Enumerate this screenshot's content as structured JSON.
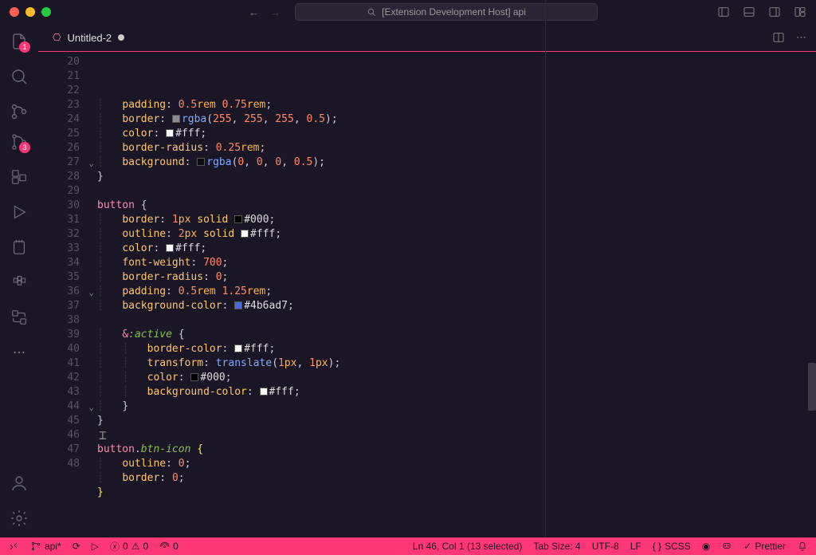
{
  "title": "[Extension Development Host] api",
  "tab": {
    "name": "Untitled-2"
  },
  "badges": {
    "explorer": "1",
    "scm": "3"
  },
  "gutter_start": 20,
  "folds": {
    "27": true,
    "36": true,
    "44": true
  },
  "code": [
    {
      "i": "    ",
      "t": [
        [
          "prop",
          "padding"
        ],
        [
          "punct",
          ": "
        ],
        [
          "num",
          "0.5"
        ],
        [
          "unit",
          "rem "
        ],
        [
          "num",
          "0.75"
        ],
        [
          "unit",
          "rem"
        ],
        [
          "punct",
          ";"
        ]
      ]
    },
    {
      "i": "    ",
      "t": [
        [
          "prop",
          "border"
        ],
        [
          "punct",
          ": "
        ],
        [
          "swatch",
          "rgba(255,255,255,0.5)"
        ],
        [
          "func",
          "rgba"
        ],
        [
          "punct",
          "("
        ],
        [
          "num",
          "255"
        ],
        [
          "punct",
          ", "
        ],
        [
          "num",
          "255"
        ],
        [
          "punct",
          ", "
        ],
        [
          "num",
          "255"
        ],
        [
          "punct",
          ", "
        ],
        [
          "num",
          "0.5"
        ],
        [
          "punct",
          ")"
        ],
        [
          "punct",
          ";"
        ]
      ]
    },
    {
      "i": "    ",
      "t": [
        [
          "prop",
          "color"
        ],
        [
          "punct",
          ": "
        ],
        [
          "swatch",
          "#fff"
        ],
        [
          "hex",
          "#fff"
        ],
        [
          "punct",
          ";"
        ]
      ]
    },
    {
      "i": "    ",
      "t": [
        [
          "prop",
          "border-radius"
        ],
        [
          "punct",
          ": "
        ],
        [
          "num",
          "0.25"
        ],
        [
          "unit",
          "rem"
        ],
        [
          "punct",
          ";"
        ]
      ]
    },
    {
      "i": "    ",
      "t": [
        [
          "prop",
          "background"
        ],
        [
          "punct",
          ": "
        ],
        [
          "swatch",
          "rgba(0,0,0,0.5)"
        ],
        [
          "func",
          "rgba"
        ],
        [
          "punct",
          "("
        ],
        [
          "num",
          "0"
        ],
        [
          "punct",
          ", "
        ],
        [
          "num",
          "0"
        ],
        [
          "punct",
          ", "
        ],
        [
          "num",
          "0"
        ],
        [
          "punct",
          ", "
        ],
        [
          "num",
          "0.5"
        ],
        [
          "punct",
          ")"
        ],
        [
          "punct",
          ";"
        ]
      ]
    },
    {
      "i": "",
      "t": [
        [
          "brace",
          "}"
        ]
      ]
    },
    {
      "i": "",
      "t": []
    },
    {
      "i": "",
      "t": [
        [
          "sel",
          "button "
        ],
        [
          "brace",
          "{"
        ]
      ]
    },
    {
      "i": "    ",
      "t": [
        [
          "prop",
          "border"
        ],
        [
          "punct",
          ": "
        ],
        [
          "num",
          "1"
        ],
        [
          "unit",
          "px "
        ],
        [
          "kw",
          "solid "
        ],
        [
          "swatch",
          "#000"
        ],
        [
          "hex",
          "#000"
        ],
        [
          "punct",
          ";"
        ]
      ]
    },
    {
      "i": "    ",
      "t": [
        [
          "prop",
          "outline"
        ],
        [
          "punct",
          ": "
        ],
        [
          "num",
          "2"
        ],
        [
          "unit",
          "px "
        ],
        [
          "kw",
          "solid "
        ],
        [
          "swatch",
          "#fff"
        ],
        [
          "hex",
          "#fff"
        ],
        [
          "punct",
          ";"
        ]
      ]
    },
    {
      "i": "    ",
      "t": [
        [
          "prop",
          "color"
        ],
        [
          "punct",
          ": "
        ],
        [
          "swatch",
          "#fff"
        ],
        [
          "hex",
          "#fff"
        ],
        [
          "punct",
          ";"
        ]
      ]
    },
    {
      "i": "    ",
      "t": [
        [
          "prop",
          "font-weight"
        ],
        [
          "punct",
          ": "
        ],
        [
          "num",
          "700"
        ],
        [
          "punct",
          ";"
        ]
      ]
    },
    {
      "i": "    ",
      "t": [
        [
          "prop",
          "border-radius"
        ],
        [
          "punct",
          ": "
        ],
        [
          "num",
          "0"
        ],
        [
          "punct",
          ";"
        ]
      ]
    },
    {
      "i": "    ",
      "t": [
        [
          "prop",
          "padding"
        ],
        [
          "punct",
          ": "
        ],
        [
          "num",
          "0.5"
        ],
        [
          "unit",
          "rem "
        ],
        [
          "num",
          "1.25"
        ],
        [
          "unit",
          "rem"
        ],
        [
          "punct",
          ";"
        ]
      ]
    },
    {
      "i": "    ",
      "t": [
        [
          "prop",
          "background-color"
        ],
        [
          "punct",
          ": "
        ],
        [
          "swatch",
          "#4b6ad7"
        ],
        [
          "hex",
          "#4b6ad7"
        ],
        [
          "punct",
          ";"
        ]
      ]
    },
    {
      "i": "",
      "t": []
    },
    {
      "i": "    ",
      "t": [
        [
          "sel",
          "&"
        ],
        [
          "selg",
          ":active "
        ],
        [
          "brace",
          "{"
        ]
      ]
    },
    {
      "i": "        ",
      "t": [
        [
          "prop",
          "border-color"
        ],
        [
          "punct",
          ": "
        ],
        [
          "swatch",
          "#fff"
        ],
        [
          "hex",
          "#fff"
        ],
        [
          "punct",
          ";"
        ]
      ]
    },
    {
      "i": "        ",
      "t": [
        [
          "prop",
          "transform"
        ],
        [
          "punct",
          ": "
        ],
        [
          "func",
          "translate"
        ],
        [
          "punct",
          "("
        ],
        [
          "num",
          "1"
        ],
        [
          "unit",
          "px"
        ],
        [
          "punct",
          ", "
        ],
        [
          "num",
          "1"
        ],
        [
          "unit",
          "px"
        ],
        [
          "punct",
          ")"
        ],
        [
          "punct",
          ";"
        ]
      ]
    },
    {
      "i": "        ",
      "t": [
        [
          "prop",
          "color"
        ],
        [
          "punct",
          ": "
        ],
        [
          "swatch",
          "#000"
        ],
        [
          "hex",
          "#000"
        ],
        [
          "punct",
          ";"
        ]
      ]
    },
    {
      "i": "        ",
      "t": [
        [
          "prop",
          "background-color"
        ],
        [
          "punct",
          ": "
        ],
        [
          "swatch",
          "#fff"
        ],
        [
          "hex",
          "#fff"
        ],
        [
          "punct",
          ";"
        ]
      ]
    },
    {
      "i": "    ",
      "t": [
        [
          "brace",
          "}"
        ]
      ]
    },
    {
      "i": "",
      "t": [
        [
          "brace",
          "}"
        ]
      ]
    },
    {
      "i": "",
      "t": []
    },
    {
      "i": "",
      "t": [
        [
          "sel",
          "button"
        ],
        [
          "punct",
          "."
        ],
        [
          "selg",
          "btn-icon "
        ],
        [
          "curbrace",
          "{"
        ]
      ]
    },
    {
      "i": "    ",
      "t": [
        [
          "prop",
          "outline"
        ],
        [
          "punct",
          ": "
        ],
        [
          "num",
          "0"
        ],
        [
          "punct",
          ";"
        ]
      ]
    },
    {
      "i": "    ",
      "t": [
        [
          "prop",
          "border"
        ],
        [
          "punct",
          ": "
        ],
        [
          "num",
          "0"
        ],
        [
          "punct",
          ";"
        ]
      ]
    },
    {
      "i": "",
      "t": [
        [
          "curbrace",
          "}"
        ]
      ]
    },
    {
      "i": "",
      "t": []
    }
  ],
  "status": {
    "remote_icon": "⎇",
    "branch": "api*",
    "sync": "⟳",
    "debug": "▷",
    "errors": "0",
    "warnings": "0",
    "ports": "0",
    "selection": "Ln 46, Col 1 (13 selected)",
    "spaces": "Tab Size: 4",
    "encoding": "UTF-8",
    "eol": "LF",
    "lang": "SCSS",
    "prettier": "Prettier"
  }
}
